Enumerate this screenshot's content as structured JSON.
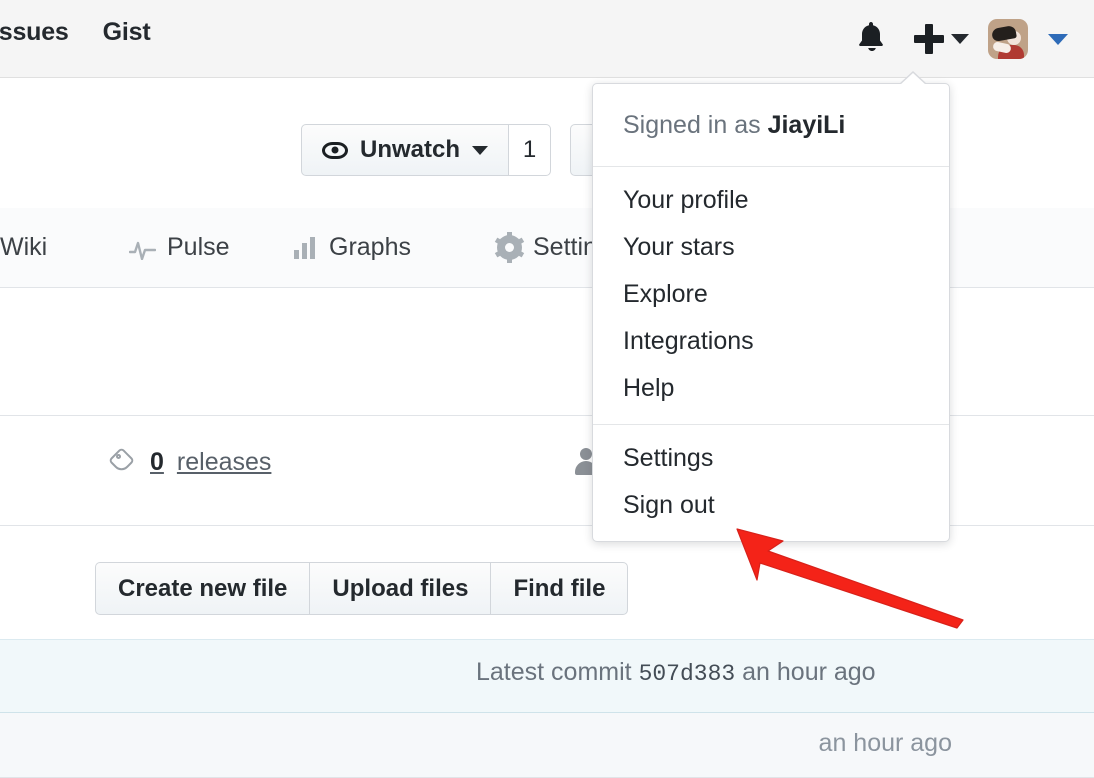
{
  "header": {
    "nav_items": [
      {
        "label": "Issues"
      },
      {
        "label": "Gist"
      }
    ],
    "icons": {
      "notifications": "bell-icon",
      "create_new": "plus-icon",
      "create_new_caret": "chevron-down-icon",
      "avatar": "user-avatar",
      "avatar_caret": "chevron-down-icon"
    }
  },
  "repo_actions": {
    "watch": {
      "icon": "eye-icon",
      "label": "Unwatch",
      "caret": "chevron-down-icon",
      "count": "1"
    }
  },
  "repo_nav": {
    "tabs": [
      {
        "label": "Wiki",
        "icon": ""
      },
      {
        "label": "Pulse",
        "icon": "pulse-icon"
      },
      {
        "label": "Graphs",
        "icon": "bar-chart-icon"
      },
      {
        "label": "Settings",
        "icon": "gear-icon"
      }
    ]
  },
  "summary": {
    "releases": {
      "icon": "tag-icon",
      "count": "0",
      "label": "releases"
    },
    "contributors": {
      "icon": "person-icon"
    }
  },
  "file_actions": {
    "buttons": [
      {
        "label": "Create new file"
      },
      {
        "label": "Upload files"
      },
      {
        "label": "Find file"
      }
    ]
  },
  "commit_bar": {
    "prefix": "Latest commit",
    "sha": "507d383",
    "time": "an hour ago"
  },
  "file_row": {
    "time": "an hour ago"
  },
  "user_dropdown": {
    "signed_in_prefix": "Signed in as",
    "username": "JiayiLi",
    "groups": [
      {
        "items": [
          {
            "label": "Your profile"
          },
          {
            "label": "Your stars"
          },
          {
            "label": "Explore"
          },
          {
            "label": "Integrations"
          },
          {
            "label": "Help"
          }
        ]
      },
      {
        "items": [
          {
            "label": "Settings"
          },
          {
            "label": "Sign out"
          }
        ]
      }
    ]
  },
  "annotation": {
    "color": "#f42318",
    "target": "Settings"
  }
}
